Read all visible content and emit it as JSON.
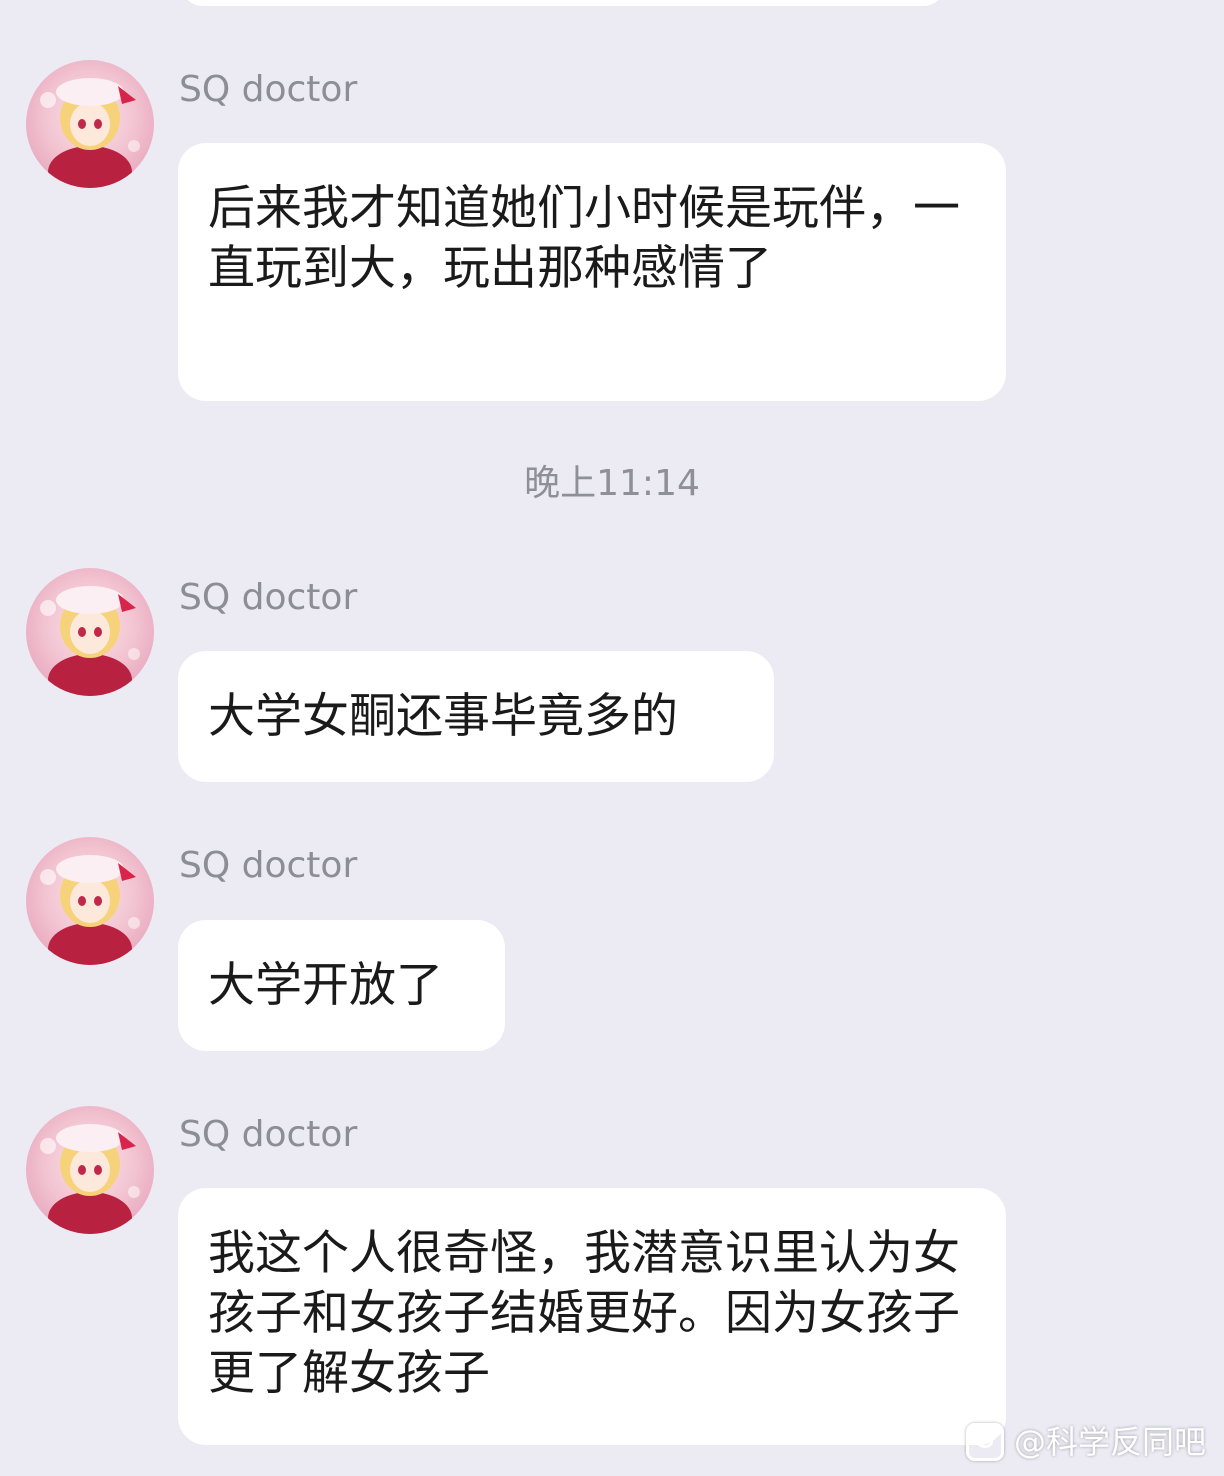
{
  "chat": {
    "time_divider": "晚上11:14",
    "messages": [
      {
        "sender": "SQ doctor",
        "text": "后来我才知道她们小时候是玩伴，一直玩到大，玩出那种感情了"
      },
      {
        "sender": "SQ doctor",
        "text": "大学女酮还事毕竟多的"
      },
      {
        "sender": "SQ doctor",
        "text": "大学开放了"
      },
      {
        "sender": "SQ doctor",
        "text": "我这个人很奇怪，我潜意识里认为女孩子和女孩子结婚更好。因为女孩子更了解女孩子"
      }
    ]
  },
  "watermark": {
    "text": "@科学反同吧",
    "icon": "tieba-logo-icon"
  },
  "colors": {
    "background": "#ecebf4",
    "bubble": "#ffffff",
    "sender_text": "#8d8d95",
    "message_text": "#1a1a1a"
  }
}
